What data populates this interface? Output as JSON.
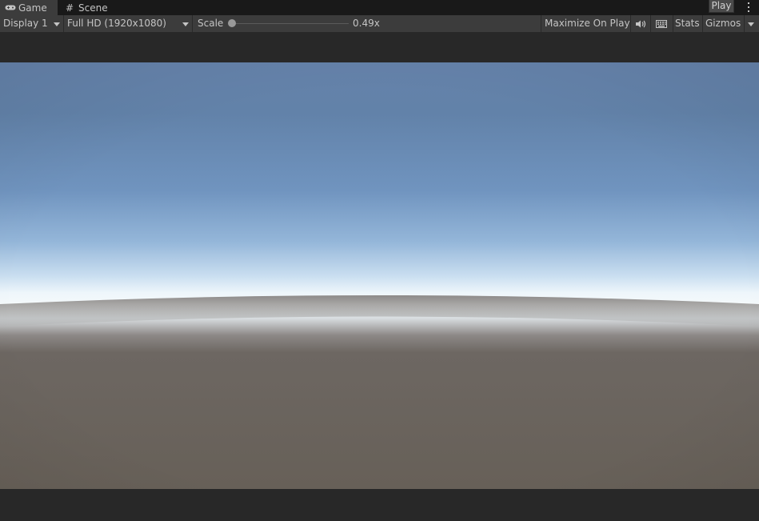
{
  "tabs": [
    {
      "label": "Game",
      "icon": "gamepad-icon",
      "active": true
    },
    {
      "label": "Scene",
      "icon": "grid-icon",
      "active": false
    }
  ],
  "play_button": {
    "label": "Play"
  },
  "toolbar": {
    "display": "Display 1",
    "resolution": "Full HD (1920x1080)",
    "scale_label": "Scale",
    "scale_value": "0.49x",
    "maximize_on_play": "Maximize On Play",
    "audio_icon": "speaker-icon",
    "stats_icon": "keyboard-icon",
    "stats": "Stats",
    "gizmos": "Gizmos"
  },
  "colors": {
    "editor_bg": "#282828",
    "toolbar_bg": "#3c3c3c",
    "sky_top": "#5f7fa6",
    "horizon": "#f1f7fb",
    "ground": "#676058"
  }
}
